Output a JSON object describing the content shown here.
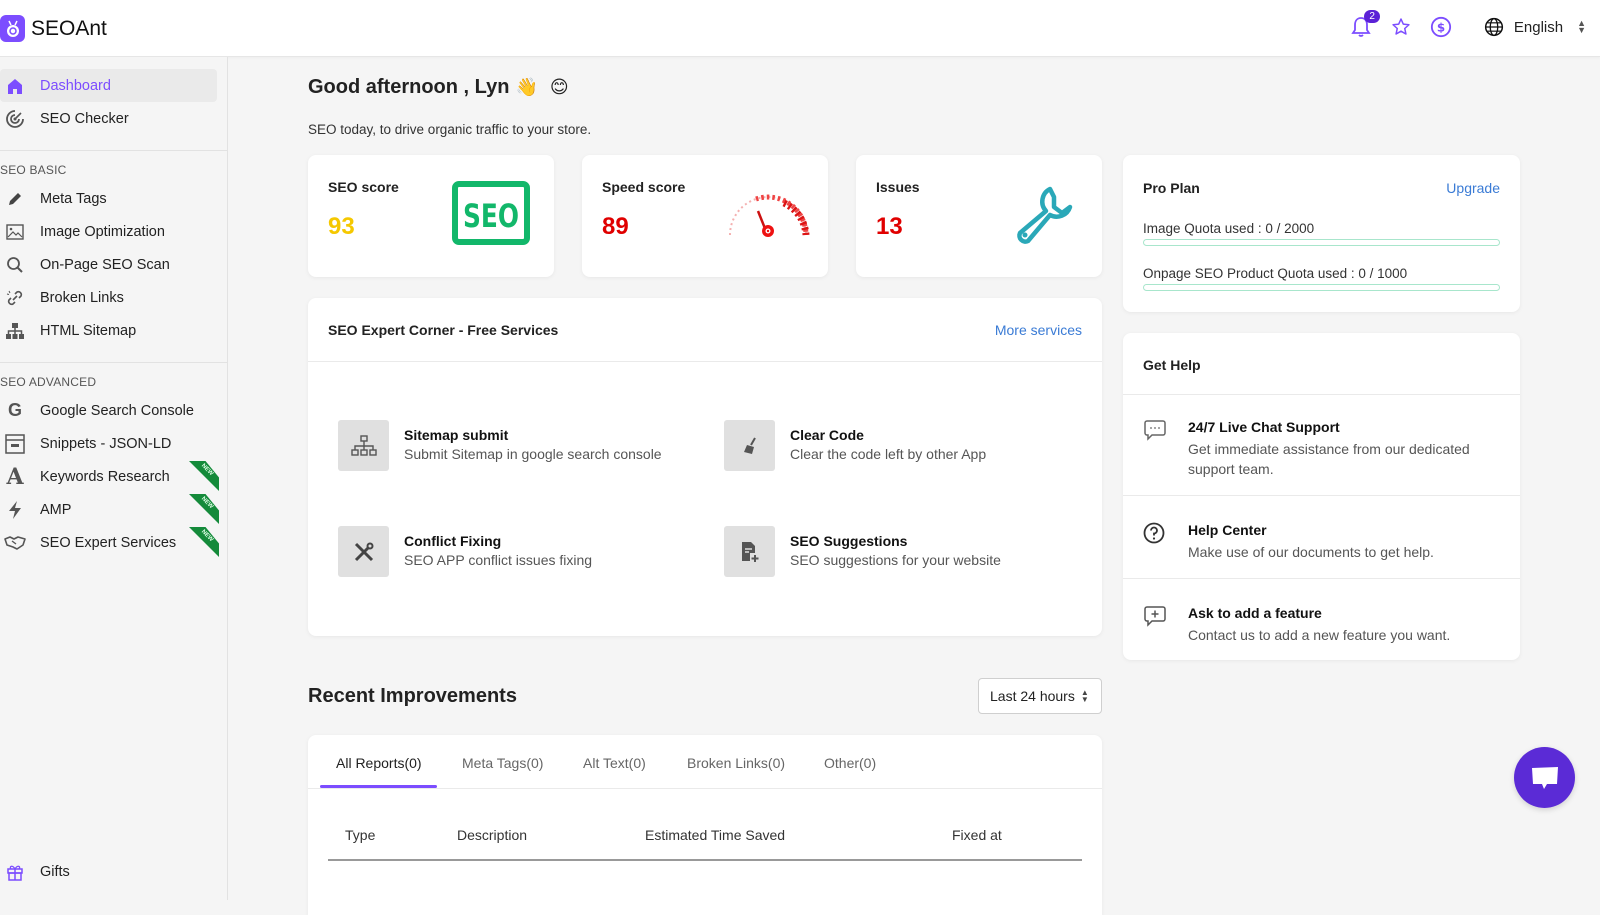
{
  "app": {
    "name": "SEOAnt"
  },
  "topbar": {
    "notification_count": "2",
    "language": "English"
  },
  "sidebar": {
    "top_items": [
      {
        "label": "Dashboard",
        "icon": "home-icon",
        "active": true
      },
      {
        "label": "SEO Checker",
        "icon": "target-icon"
      }
    ],
    "basic_label": "SEO BASIC",
    "basic_items": [
      {
        "label": "Meta Tags",
        "icon": "pencil-icon"
      },
      {
        "label": "Image Optimization",
        "icon": "image-icon"
      },
      {
        "label": "On-Page SEO Scan",
        "icon": "search-icon"
      },
      {
        "label": "Broken Links",
        "icon": "broken-link-icon"
      },
      {
        "label": "HTML Sitemap",
        "icon": "sitemap-icon"
      }
    ],
    "advanced_label": "SEO ADVANCED",
    "advanced_items": [
      {
        "label": "Google Search Console",
        "icon": "google-icon"
      },
      {
        "label": "Snippets - JSON-LD",
        "icon": "snippet-icon"
      },
      {
        "label": "Keywords Research",
        "icon": "font-icon",
        "badge": "NEW"
      },
      {
        "label": "AMP",
        "icon": "bolt-icon",
        "badge": "NEW"
      },
      {
        "label": "SEO Expert Services",
        "icon": "handshake-icon",
        "badge": "NEW"
      }
    ],
    "gifts_label": "Gifts"
  },
  "greeting": {
    "title": "Good afternoon , Lyn",
    "emoji_wave": "👋",
    "emoji_smile": "😊",
    "subtitle": "SEO today, to drive organic traffic to your store."
  },
  "stats": [
    {
      "label": "SEO score",
      "value": "93",
      "color": "#f5c800"
    },
    {
      "label": "Speed score",
      "value": "89",
      "color": "#e00000"
    },
    {
      "label": "Issues",
      "value": "13",
      "color": "#e00000"
    }
  ],
  "plan": {
    "title": "Pro Plan",
    "upgrade_label": "Upgrade",
    "quotas": [
      {
        "label": "Image Quota used : 0 / 2000",
        "used": 0,
        "total": 2000
      },
      {
        "label": "Onpage SEO Product Quota used : 0 / 1000",
        "used": 0,
        "total": 1000
      }
    ]
  },
  "expert": {
    "title": "SEO Expert Corner - Free Services",
    "more_label": "More services",
    "services": [
      {
        "title": "Sitemap submit",
        "desc": "Submit Sitemap in google search console",
        "icon": "sitemap-icon"
      },
      {
        "title": "Clear Code",
        "desc": "Clear the code left by other App",
        "icon": "broom-icon"
      },
      {
        "title": "Conflict Fixing",
        "desc": "SEO APP conflict issues fixing",
        "icon": "tools-icon"
      },
      {
        "title": "SEO Suggestions",
        "desc": "SEO suggestions for your website",
        "icon": "document-plus-icon"
      }
    ]
  },
  "help": {
    "title": "Get Help",
    "items": [
      {
        "title": "24/7 Live Chat Support",
        "desc": "Get immediate assistance from our dedicated support team.",
        "icon": "chat-icon"
      },
      {
        "title": "Help Center",
        "desc": "Make use of our documents to get help.",
        "icon": "question-icon"
      },
      {
        "title": "Ask to add a feature",
        "desc": "Contact us to add a new feature you want.",
        "icon": "chat-plus-icon"
      }
    ]
  },
  "recent": {
    "title": "Recent Improvements",
    "range": "Last 24 hours",
    "tabs": [
      "All Reports(0)",
      "Meta Tags(0)",
      "Alt Text(0)",
      "Broken Links(0)",
      "Other(0)"
    ],
    "active_tab": 0,
    "columns": [
      "Type",
      "Description",
      "Estimated Time Saved",
      "Fixed at"
    ],
    "rows": []
  },
  "colors": {
    "accent": "#7c4dff",
    "link": "#3a7bd5",
    "seo_green": "#12b76a",
    "wrench_teal": "#2aa8b8"
  }
}
